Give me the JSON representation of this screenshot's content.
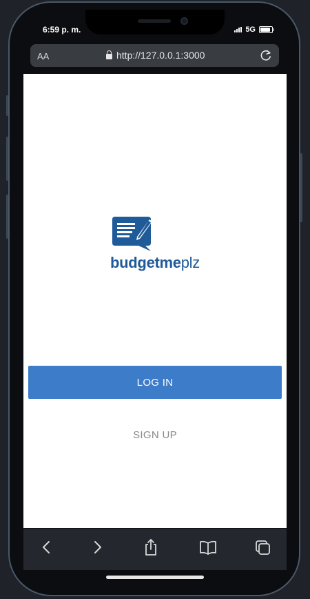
{
  "status_bar": {
    "time": "6:59 p. m.",
    "network": "5G"
  },
  "browser": {
    "text_size_label": "AA",
    "url": "http://127.0.0.1:3000"
  },
  "app": {
    "brand_bold": "budgetme",
    "brand_light": "plz",
    "login_label": "LOG IN",
    "signup_label": "SIGN UP"
  },
  "colors": {
    "brand": "#1f5a99",
    "primary_button": "#3d7cc9",
    "toolbar": "#24282e"
  },
  "icons": {
    "toolbar": [
      "chevron-left-icon",
      "chevron-right-icon",
      "share-icon",
      "bookmarks-icon",
      "tabs-icon"
    ]
  }
}
